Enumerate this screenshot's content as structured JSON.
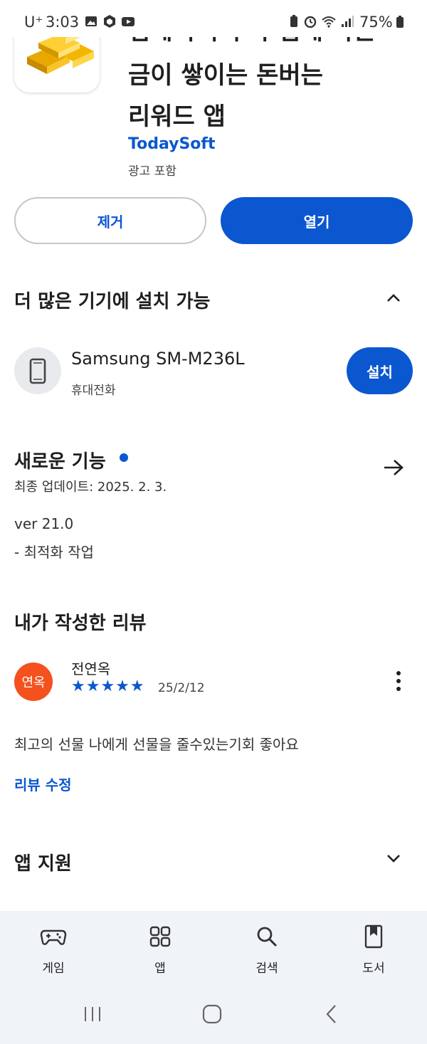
{
  "status_bar": {
    "carrier": "U⁺",
    "time": "3:03",
    "battery": "75%"
  },
  "app": {
    "title_line1": "집에서 누구나 쉽게 하는",
    "title_line2": "금이 쌓이는 돈버는",
    "title_line3": "리워드 앱",
    "developer": "TodaySoft",
    "ads_note": "광고 포함",
    "icon": "gold-bars-icon"
  },
  "actions": {
    "uninstall_label": "제거",
    "open_label": "열기"
  },
  "more_devices": {
    "title": "더 많은 기기에 설치 가능",
    "device_name": "Samsung SM-M236L",
    "device_type": "휴대전화",
    "install_label": "설치"
  },
  "whats_new": {
    "title": "새로운 기능",
    "updated": "최종 업데이트: 2025. 2. 3.",
    "version": "ver 21.0",
    "notes": "- 최적화 작업"
  },
  "my_review": {
    "title": "내가 작성한 리뷰",
    "avatar_text": "연옥",
    "reviewer_name": "전연옥",
    "stars": "★★★★★",
    "rating": 5,
    "date": "25/2/12",
    "text": "최고의 선물 나에게 선물을 줄수있는기회 좋아요",
    "edit_label": "리뷰 수정"
  },
  "app_support": {
    "title": "앱 지원"
  },
  "bottom_nav": {
    "items": [
      {
        "label": "게임",
        "icon": "gamepad-icon"
      },
      {
        "label": "앱",
        "icon": "apps-grid-icon"
      },
      {
        "label": "검색",
        "icon": "search-icon"
      },
      {
        "label": "도서",
        "icon": "book-icon"
      }
    ]
  },
  "colors": {
    "accent": "#0b57d0",
    "avatar": "#f4511e",
    "nav_background": "#f0f4f9"
  }
}
